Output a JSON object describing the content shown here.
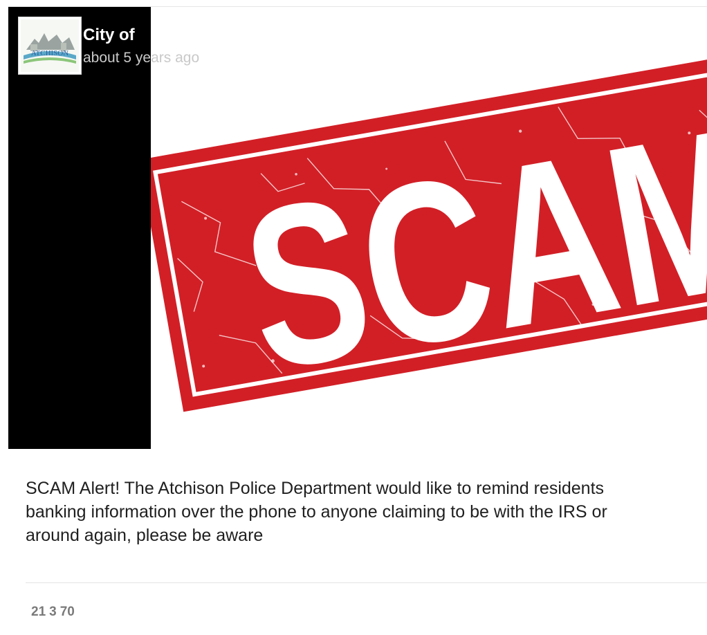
{
  "post": {
    "author": "City of",
    "time": "about 5 years ago",
    "avatar_icon": "city-of-atchison-logo",
    "avatar_text": "ATCHISON",
    "image_icon": "scam-stamp-image",
    "image_text": "SCAM",
    "text_lines": [
      "SCAM Alert! The Atchison Police Department would like to remind residents",
      "banking information over the phone to anyone claiming to be with the IRS or",
      "around again, please be aware"
    ],
    "reactions": [
      "21",
      "3",
      "70"
    ]
  },
  "colors": {
    "stamp_red": "#d21f26",
    "panel": "#000000",
    "text": "#1f1f1f",
    "muted": "#7a7a7a"
  }
}
